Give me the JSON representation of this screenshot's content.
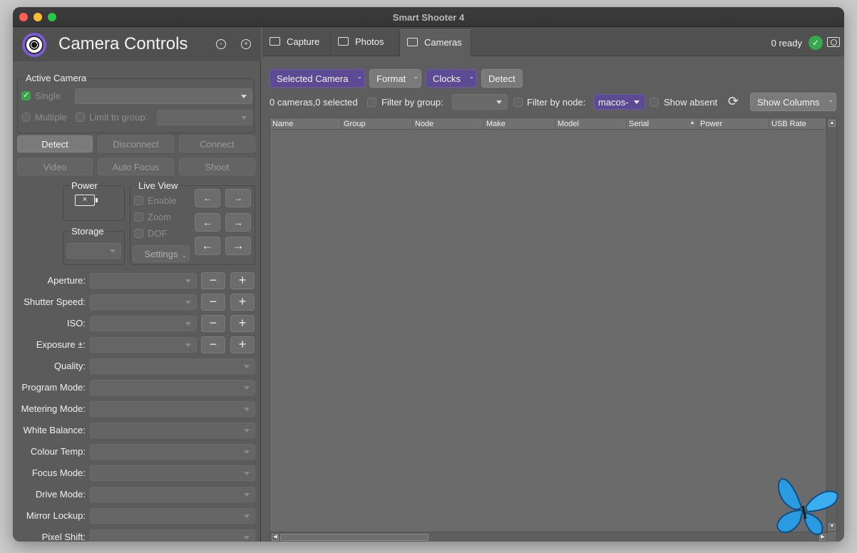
{
  "window": {
    "title": "Smart Shooter 4"
  },
  "left": {
    "title": "Camera Controls",
    "active_camera": {
      "legend": "Active Camera",
      "single_label": "Single",
      "multiple_label": "Multiple",
      "limit_label": "Limit to group:"
    },
    "buttons": {
      "detect": "Detect",
      "disconnect": "Disconnect",
      "connect": "Connect",
      "video": "Video",
      "autofocus": "Auto Focus",
      "shoot": "Shoot"
    },
    "power_legend": "Power",
    "storage_legend": "Storage",
    "live_view": {
      "legend": "Live View",
      "enable": "Enable",
      "zoom": "Zoom",
      "dof": "DOF",
      "settings": "Settings"
    },
    "settings": [
      "Aperture:",
      "Shutter Speed:",
      "ISO:",
      "Exposure ±:",
      "Quality:",
      "Program Mode:",
      "Metering Mode:",
      "White Balance:",
      "Colour Temp:",
      "Focus Mode:",
      "Drive Mode:",
      "Mirror Lockup:",
      "Pixel Shift:"
    ]
  },
  "right": {
    "tabs": [
      "Capture",
      "Photos",
      "Cameras"
    ],
    "active_tab": "Cameras",
    "ready_text": "0 ready",
    "toolbar": {
      "selected_camera": "Selected Camera",
      "format": "Format",
      "clocks": "Clocks",
      "detect": "Detect"
    },
    "filter": {
      "summary": "0 cameras,0 selected",
      "by_group": "Filter by group:",
      "by_node": "Filter by node:",
      "node_value": "macos-",
      "show_absent": "Show absent",
      "show_columns": "Show Columns"
    },
    "columns": [
      "Name",
      "Group",
      "Node",
      "Make",
      "Model",
      "Serial",
      "Power",
      "USB Rate"
    ]
  },
  "colors": {
    "accent_purple": "#5d4a94",
    "ready_green": "#38a84c",
    "butterfly_blue": "#2a9be0"
  }
}
